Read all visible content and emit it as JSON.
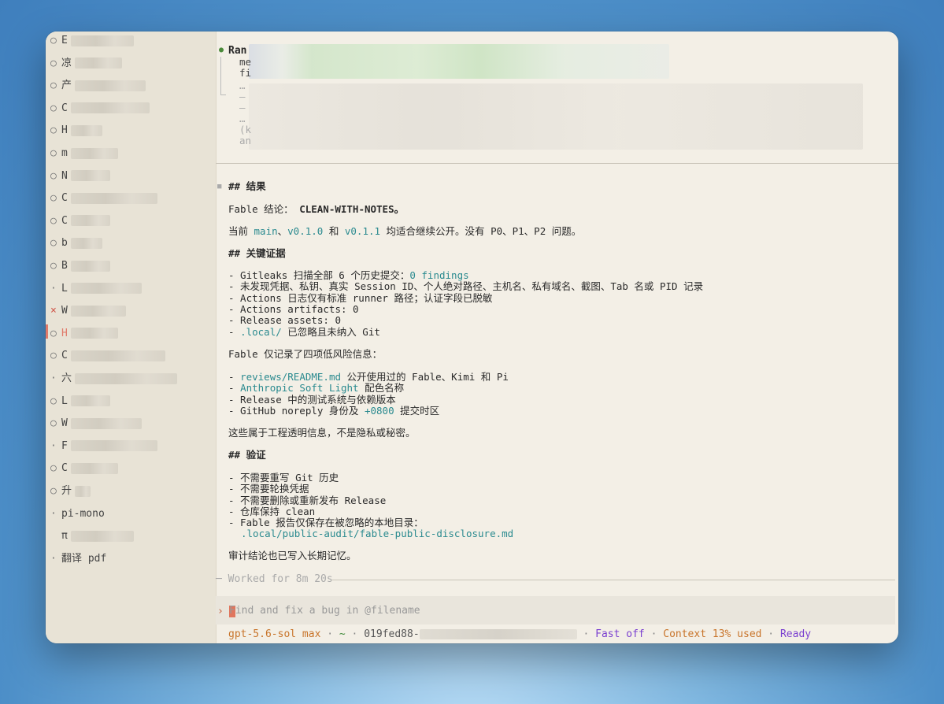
{
  "sidebar": {
    "items": [
      {
        "mark": "○",
        "label": "E"
      },
      {
        "mark": "○",
        "label": "凉"
      },
      {
        "mark": "○",
        "label": "产"
      },
      {
        "mark": "○",
        "label": "C"
      },
      {
        "mark": "○",
        "label": "H"
      },
      {
        "mark": "○",
        "label": "m"
      },
      {
        "mark": "○",
        "label": "N"
      },
      {
        "mark": "○",
        "label": "C"
      },
      {
        "mark": "○",
        "label": "C"
      },
      {
        "mark": "○",
        "label": "b"
      },
      {
        "mark": "○",
        "label": "B"
      },
      {
        "mark": "·",
        "label": "L"
      },
      {
        "mark": "×",
        "label": "W"
      },
      {
        "mark": "○",
        "label": "H"
      },
      {
        "mark": "○",
        "label": "C"
      },
      {
        "mark": "·",
        "label": "六"
      },
      {
        "mark": "○",
        "label": "L"
      },
      {
        "mark": "○",
        "label": "W"
      },
      {
        "mark": "·",
        "label": "F"
      },
      {
        "mark": "○",
        "label": "C"
      },
      {
        "mark": "○",
        "label": "升"
      },
      {
        "mark": "·",
        "label": "pi-mono"
      },
      {
        "mark": "",
        "label": "π"
      },
      {
        "mark": "·",
        "label": "翻译 pdf"
      }
    ]
  },
  "tool_call": {
    "title": "Ran",
    "lines": [
      "me",
      "fi",
      "…",
      "–",
      "–",
      "…",
      "(k",
      "an"
    ]
  },
  "result": {
    "h_result": "## 结果",
    "verdict_prefix": "Fable 结论：",
    "verdict": "CLEAN-WITH-NOTES。",
    "status_line_parts": [
      "当前 ",
      "main",
      "、",
      "v0.1.0",
      " 和 ",
      "v0.1.1",
      " 均适合继续公开。没有 P0、P1、P2 问题。"
    ],
    "h_evidence": "## 关键证据",
    "evidence": [
      {
        "text": "- Gitleaks 扫描全部 6 个历史提交：",
        "hl": "0 findings",
        "after": ""
      },
      {
        "text": "- 未发现凭据、私钥、真实 Session ID、个人绝对路径、主机名、私有域名、截图、Tab 名或 PID 记录",
        "hl": "",
        "after": ""
      },
      {
        "text": "- Actions 日志仅有标准 runner 路径；认证字段已脱敏",
        "hl": "",
        "after": ""
      },
      {
        "text": "- Actions artifacts: 0",
        "hl": "",
        "after": ""
      },
      {
        "text": "- Release assets: 0",
        "hl": "",
        "after": ""
      },
      {
        "text": "- ",
        "hl": ".local/",
        "after": " 已忽略且未纳入 Git"
      }
    ],
    "low_risk_intro": "Fable 仅记录了四项低风险信息：",
    "low_risk": [
      {
        "text": "- ",
        "hl": "reviews/README.md",
        "after": " 公开使用过的 Fable、Kimi 和 Pi"
      },
      {
        "text": "- ",
        "hl": "Anthropic Soft Light",
        "after": " 配色名称"
      },
      {
        "text": "- Release 中的测试系统与依赖版本",
        "hl": "",
        "after": ""
      },
      {
        "text": "- GitHub noreply 身份及 ",
        "hl": "+0800",
        "after": " 提交时区"
      }
    ],
    "low_risk_note": "这些属于工程透明信息，不是隐私或秘密。",
    "h_verify": "## 验证",
    "verify": [
      "- 不需要重写 Git 历史",
      "- 不需要轮换凭据",
      "- 不需要删除或重新发布 Release",
      "- 仓库保持 clean",
      "- Fable 报告仅保存在被忽略的本地目录："
    ],
    "verify_path": ".local/public-audit/fable-public-disclosure.md",
    "memory_note": "审计结论也已写入长期记忆。"
  },
  "worked": "─ Worked for 8m 20s",
  "input": {
    "prompt": "›",
    "placeholder": "Find and fix a bug in @filename"
  },
  "status_bar": {
    "model": "gpt-5.6-sol max",
    "dir": "~",
    "session": "019fed88-",
    "fast": "Fast off",
    "context": "Context 13% used",
    "state": "Ready",
    "sep": " · "
  },
  "colors": {
    "accent_teal": "#2a8a8f",
    "model_orange": "#c8742a",
    "status_purple": "#7a3fd0",
    "error_red": "#e07a6a"
  }
}
